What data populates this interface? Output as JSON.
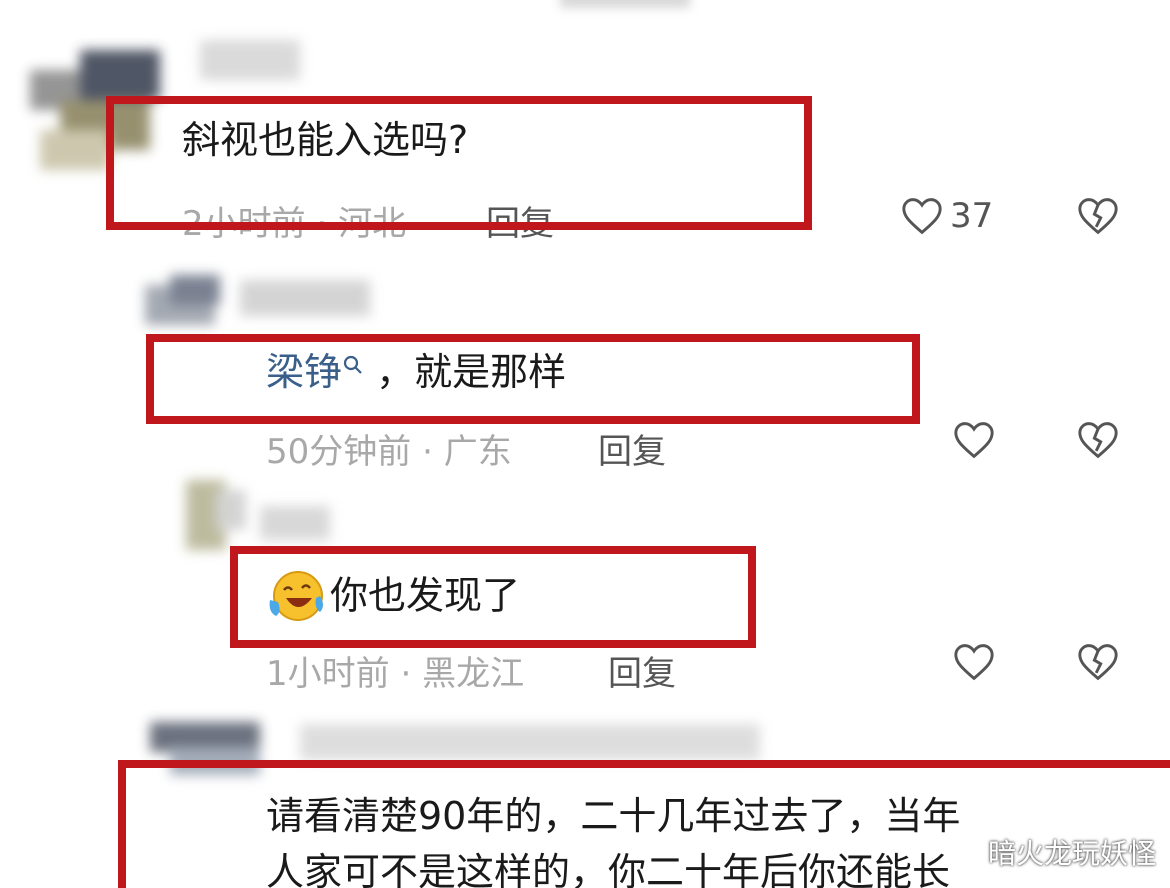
{
  "comments": [
    {
      "text": "斜视也能入选吗?",
      "time": "2小时前",
      "location": "河北",
      "separator": "·",
      "reply_label": "回复",
      "likes": "37"
    },
    {
      "mention": "梁铮",
      "text": "，就是那样",
      "time": "50分钟前",
      "location": "广东",
      "separator": "·",
      "reply_label": "回复"
    },
    {
      "text": "你也发现了",
      "emoji": "laughing-crying-emoji",
      "time": "1小时前",
      "location": "黑龙江",
      "separator": "·",
      "reply_label": "回复"
    },
    {
      "line1": "请看清楚90年的，二十几年过去了，当年",
      "line2": "人家可不是这样的，你二十年后你还能长"
    }
  ],
  "watermark": "暗火龙玩妖怪",
  "colors": {
    "highlight": "#c0171c",
    "mention": "#3a5f8a",
    "meta": "#a8a8a8"
  }
}
